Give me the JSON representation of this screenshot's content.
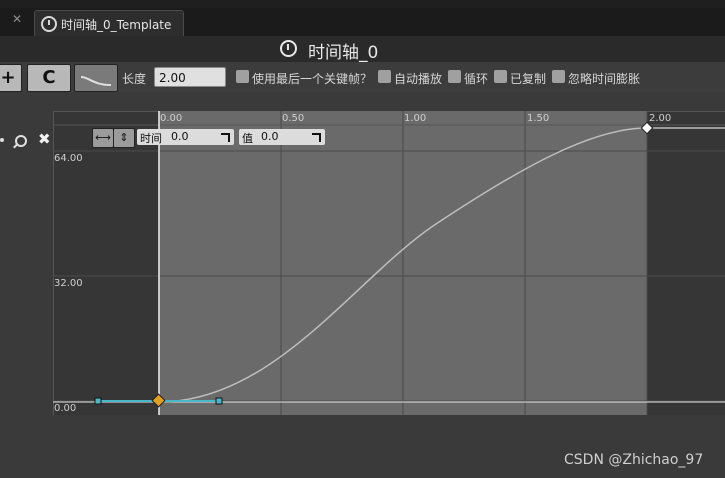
{
  "tabs": {
    "closed_x": "✕",
    "active_label": "时间轴_0_Template"
  },
  "title": "时间轴_0",
  "toolbar": {
    "btn_add_key": "+",
    "btn_curve": "C",
    "length_label": "长度",
    "length_value": "2.00",
    "checkboxes": [
      "使用最后一个关键帧？",
      "自动播放",
      "循环",
      "已复制",
      "忽略时间膨胀"
    ]
  },
  "graph": {
    "time_ticks": [
      "0.00",
      "0.50",
      "1.00",
      "1.50",
      "2.00"
    ],
    "value_ticks": [
      "64.00",
      "32.00",
      "0.00"
    ],
    "time_label": "时间",
    "time_value": "0.0",
    "value_label": "值",
    "value_value": "0.0",
    "icons": {
      "fit_horizontal": "⟷",
      "fit_vertical": "⇕"
    }
  },
  "watermark": "CSDN @Zhichao_97",
  "colors": {
    "key_selected": "#e0a020",
    "key_end": "#ffffff",
    "tangent": "#4ab7c8",
    "curve": "#bdbdbd",
    "active_range": "#6a6a6a"
  }
}
